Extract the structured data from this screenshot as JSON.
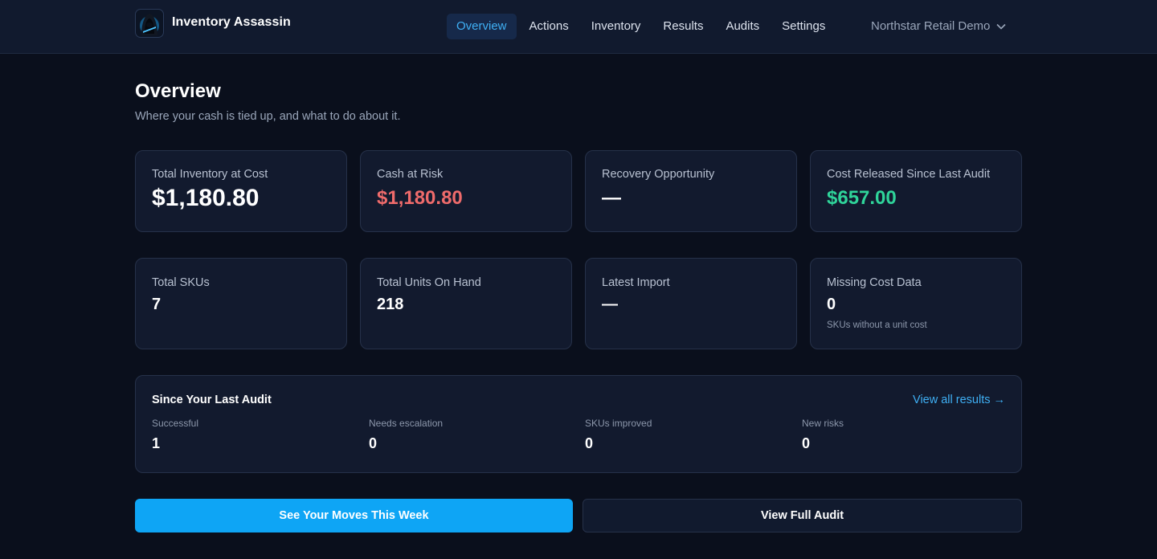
{
  "app": {
    "name": "Inventory Assassin",
    "logo_icon": "hooded-assassin-logo"
  },
  "nav": {
    "items": [
      {
        "label": "Overview",
        "active": true
      },
      {
        "label": "Actions",
        "active": false
      },
      {
        "label": "Inventory",
        "active": false
      },
      {
        "label": "Results",
        "active": false
      },
      {
        "label": "Audits",
        "active": false
      },
      {
        "label": "Settings",
        "active": false
      }
    ],
    "org": "Northstar Retail Demo"
  },
  "page": {
    "title": "Overview",
    "subtitle": "Where your cash is tied up, and what to do about it."
  },
  "metrics_top": [
    {
      "label": "Total Inventory at Cost",
      "value": "$1,180.80",
      "tone": "default"
    },
    {
      "label": "Cash at Risk",
      "value": "$1,180.80",
      "tone": "red"
    },
    {
      "label": "Recovery Opportunity",
      "value": "—",
      "tone": "default"
    },
    {
      "label": "Cost Released Since Last Audit",
      "value": "$657.00",
      "tone": "green"
    }
  ],
  "metrics_bottom": [
    {
      "label": "Total SKUs",
      "value": "7"
    },
    {
      "label": "Total Units On Hand",
      "value": "218"
    },
    {
      "label": "Latest Import",
      "value": "—"
    },
    {
      "label": "Missing Cost Data",
      "value": "0",
      "note": "SKUs without a unit cost"
    }
  ],
  "last_audit": {
    "title": "Since Your Last Audit",
    "link": "View all results →",
    "stats": [
      {
        "label": "Successful",
        "value": "1"
      },
      {
        "label": "Needs escalation",
        "value": "0"
      },
      {
        "label": "SKUs improved",
        "value": "0"
      },
      {
        "label": "New risks",
        "value": "0"
      }
    ]
  },
  "actions": {
    "primary": "See Your Moves This Week",
    "secondary": "View Full Audit"
  },
  "colors": {
    "accent": "#0ea5f5",
    "negative": "#ef6b6b",
    "positive": "#2fd49a",
    "background": "#0a0f1c",
    "card": "#121a2e"
  }
}
